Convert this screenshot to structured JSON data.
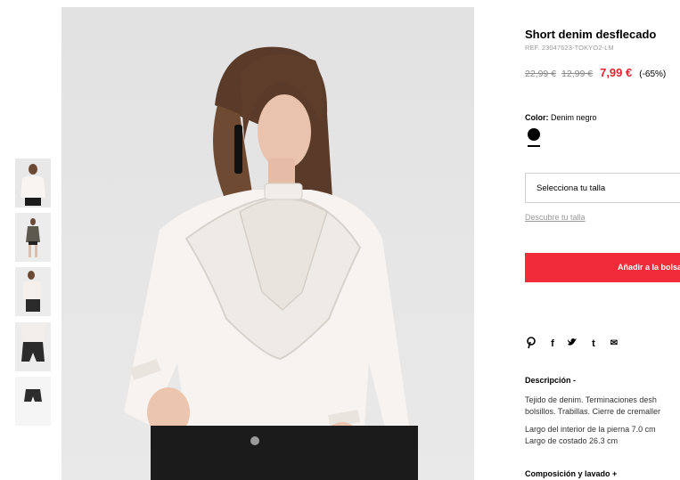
{
  "product": {
    "title": "Short denim desflecado",
    "ref": "REF. 23047623-TOKYO2-LM",
    "price_old_1": "22,99 €",
    "price_old_2": "12,99 €",
    "price_new": "7,99 €",
    "discount": "(-65%)"
  },
  "color": {
    "label": "Color:",
    "value": "Denim negro",
    "swatch_color": "#000000"
  },
  "size": {
    "select_label": "Selecciona tu talla",
    "link": "Descubre tu talla"
  },
  "cart": {
    "add_label": "Añadir a la bolsa"
  },
  "social": {
    "icons": [
      "pinterest-icon",
      "facebook-icon",
      "twitter-icon",
      "tumblr-icon",
      "email-icon"
    ],
    "glyphs": [
      "P",
      "f",
      "t",
      "t",
      "✉"
    ]
  },
  "description": {
    "title": "Descripción -",
    "line1": "Tejido de denim. Terminaciones desh",
    "line2": "bolsillos. Trabillas. Cierre de cremaller",
    "line3": "Largo del interior de la pierna 7.0 cm",
    "line4": "Largo de costado 26.3 cm"
  },
  "composition": {
    "title": "Composición y lavado +"
  },
  "colors": {
    "accent_red": "#e5232f",
    "button_red": "#f12b3a",
    "image_bg": "#e6e6e6"
  }
}
